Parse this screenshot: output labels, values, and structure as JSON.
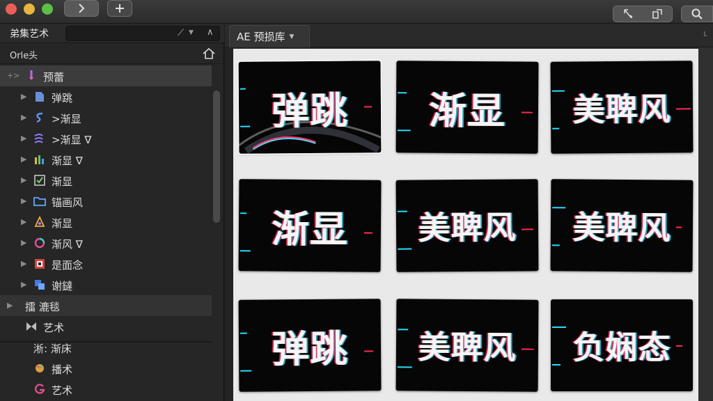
{
  "titlebar": {
    "icons": [
      "close-light",
      "minimize-light",
      "zoom-light",
      "forward-icon",
      "plus-icon",
      "pen-tool-icon",
      "share-icon",
      "search-icon"
    ]
  },
  "sidebar": {
    "title": "弟集艺术",
    "subheader": "Orle头",
    "items": [
      {
        "label": "预蕾",
        "icon": "brush-icon",
        "arrow": "+>",
        "state": "selected"
      },
      {
        "label": "弹跳",
        "icon": "doc-icon",
        "arrow": "▶"
      },
      {
        "label": ">渐显",
        "icon": "s-curve-icon",
        "arrow": "▶"
      },
      {
        "label": ">渐显 ∇",
        "icon": "wave-icon",
        "arrow": "▶"
      },
      {
        "label": "渐显 ∇",
        "icon": "levels-icon",
        "arrow": "▶"
      },
      {
        "label": "渐显",
        "icon": "check-box-icon",
        "arrow": "▶"
      },
      {
        "label": "锚画风",
        "icon": "folder-icon",
        "arrow": "▶"
      },
      {
        "label": "渐显",
        "icon": "cone-icon",
        "arrow": "▶"
      },
      {
        "label": "渐风 ∇",
        "icon": "ring-icon",
        "arrow": "▶"
      },
      {
        "label": "是面念",
        "icon": "grid-icon",
        "arrow": "▶"
      },
      {
        "label": "谢鐽",
        "icon": "stack-icon",
        "arrow": "▶"
      },
      {
        "label": "擂 漉毯",
        "icon": "none",
        "arrow": "▶",
        "state": "hover"
      },
      {
        "label": "艺术",
        "icon": "bowtie-icon",
        "arrow": ""
      },
      {
        "label": "淅: 渐床",
        "icon": "none",
        "arrow": ""
      },
      {
        "label": "播术",
        "icon": "palette-icon",
        "arrow": ""
      },
      {
        "label": "艺术",
        "icon": "g-icon",
        "arrow": ""
      }
    ]
  },
  "main": {
    "tab_label": "AE 预损库",
    "corner_mark": "L",
    "tiles": [
      {
        "text": "弹跳",
        "style": "swoosh",
        "selected": true
      },
      {
        "text": "渐显"
      },
      {
        "text": "美聛风"
      },
      {
        "text": "渐显"
      },
      {
        "text": "美聛风"
      },
      {
        "text": "美聛风"
      },
      {
        "text": "弹跳"
      },
      {
        "text": "美聛风"
      },
      {
        "text": "负娴态"
      }
    ]
  },
  "colors": {
    "accent_red": "#ec5f57",
    "accent_yellow": "#e9b53c",
    "accent_green": "#5dbf45",
    "glitch_red": "#ff285a",
    "glitch_cyan": "#28dcff"
  }
}
